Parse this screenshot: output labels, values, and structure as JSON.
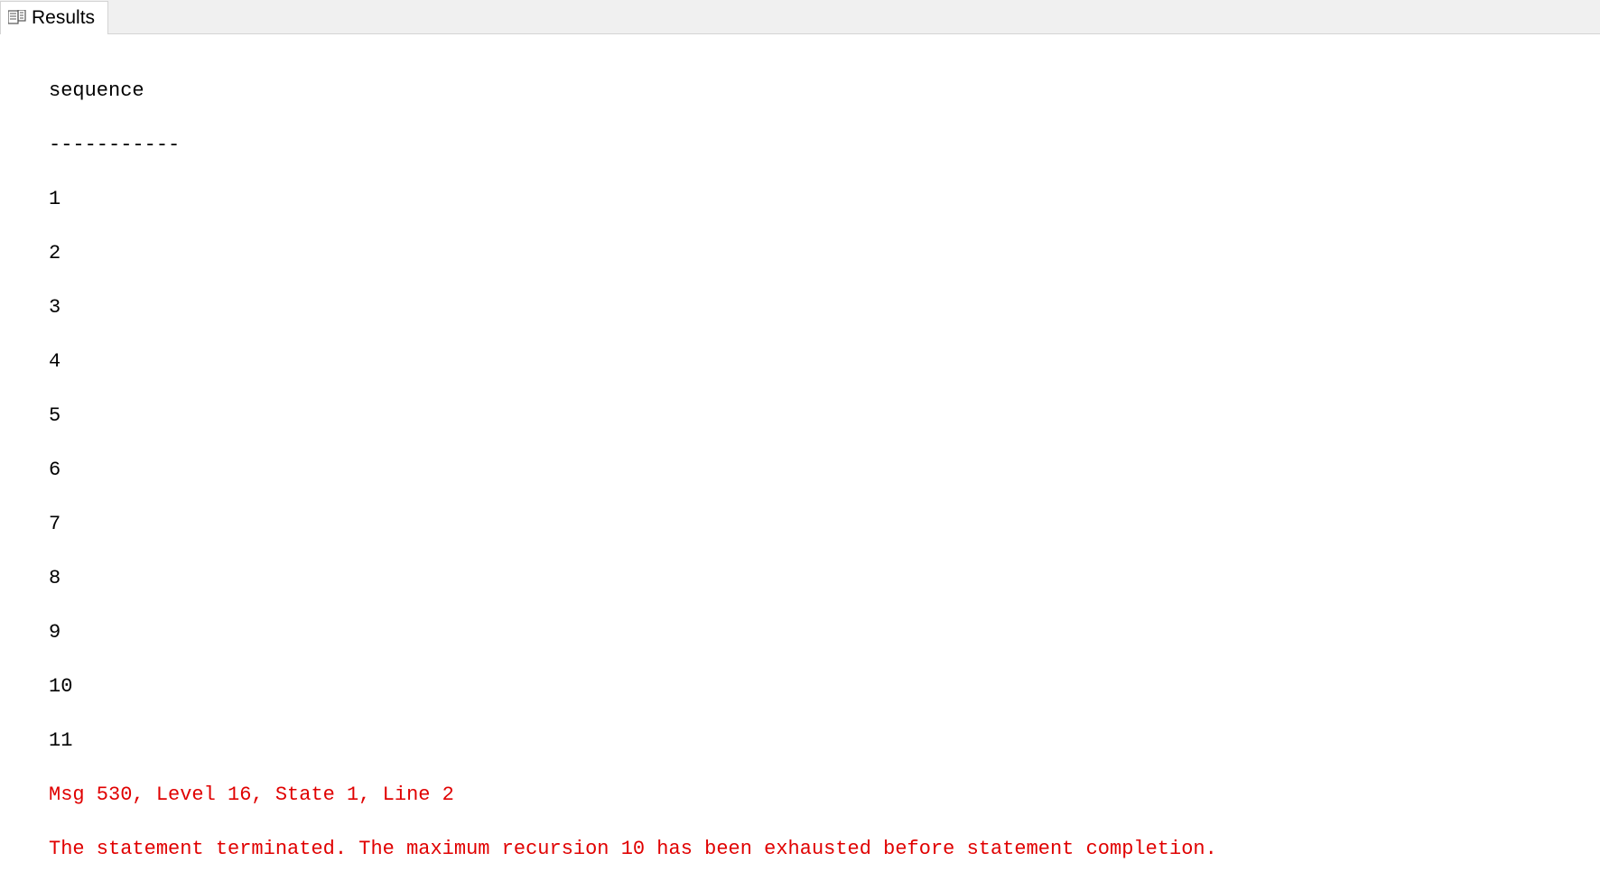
{
  "tab": {
    "label": "Results"
  },
  "results": {
    "column_header": "sequence",
    "separator": "-----------",
    "rows": [
      "1",
      "2",
      "3",
      "4",
      "5",
      "6",
      "7",
      "8",
      "9",
      "10",
      "11"
    ]
  },
  "error": {
    "line1": "Msg 530, Level 16, State 1, Line 2",
    "line2": "The statement terminated. The maximum recursion 10 has been exhausted before statement completion."
  }
}
